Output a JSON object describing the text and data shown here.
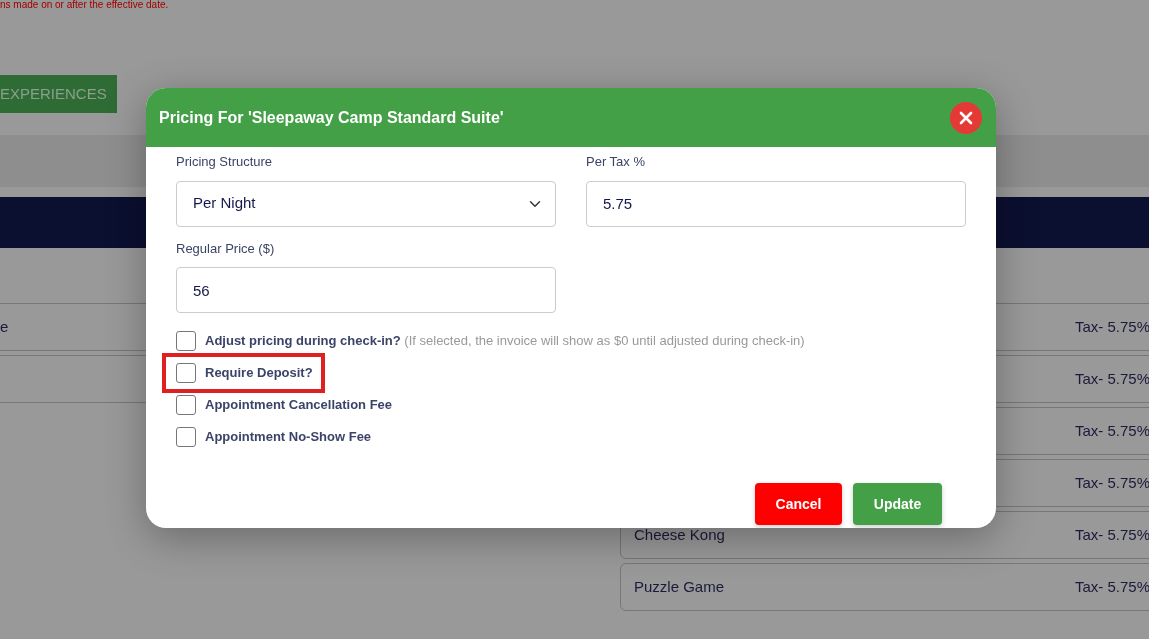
{
  "background": {
    "notice": "ns made on or after the effective date.",
    "tab_button": "EXPERIENCES",
    "left_rows": [
      {
        "name": "e"
      },
      {}
    ],
    "right_rows": [
      {
        "tax": "Tax- 5.75%"
      },
      {
        "tax": "Tax- 5.75%"
      },
      {
        "tax": "Tax- 5.75%"
      },
      {
        "tax": "Tax- 5.75%"
      },
      {
        "name": "Cheese Kong",
        "tax": "Tax- 5.75%"
      },
      {
        "name": "Puzzle Game",
        "tax": "Tax- 5.75%"
      }
    ]
  },
  "modal": {
    "title": "Pricing For 'Sleepaway Camp Standard Suite'",
    "fields": [
      {
        "kind": "select",
        "label": "Pricing Structure",
        "value": "Per Night"
      },
      {
        "kind": "text",
        "label": "Per Tax %",
        "value": "5.75"
      },
      {
        "kind": "text",
        "label": "Regular Price ($)",
        "value": "56"
      }
    ],
    "checkboxes": [
      {
        "label": "Adjust pricing during check-in?",
        "hint": "(If selected, the invoice will show as $0 until adjusted during check-in)",
        "checked": false,
        "highlighted": false
      },
      {
        "label": "Require Deposit?",
        "checked": false,
        "highlighted": true
      },
      {
        "label": "Appointment Cancellation Fee",
        "checked": false,
        "highlighted": false
      },
      {
        "label": "Appointment No-Show Fee",
        "checked": false,
        "highlighted": false
      }
    ],
    "buttons": [
      {
        "kind": "cancel",
        "label": "Cancel"
      },
      {
        "kind": "update",
        "label": "Update"
      }
    ]
  }
}
